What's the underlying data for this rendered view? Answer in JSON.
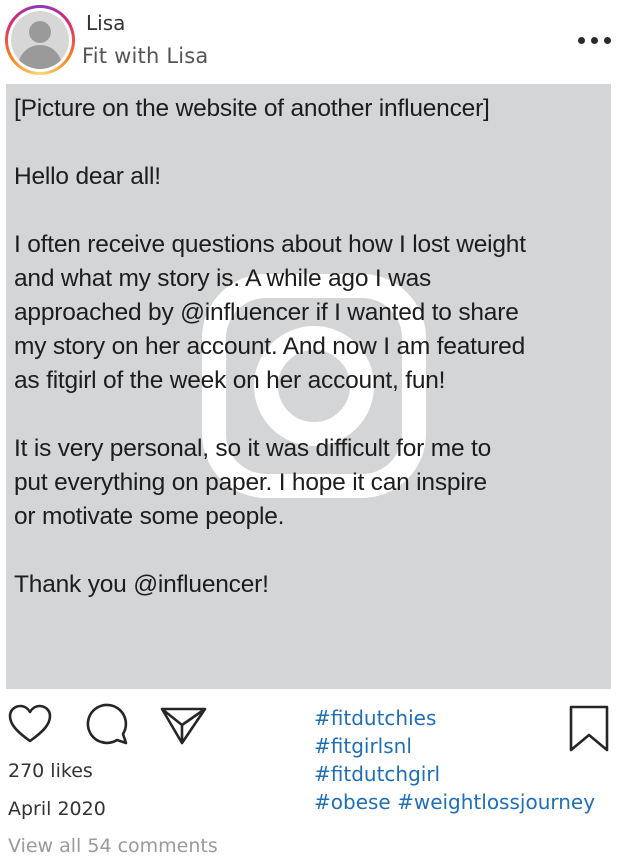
{
  "header": {
    "username": "Lisa",
    "subtitle": "Fit with Lisa"
  },
  "post": {
    "lines": [
      "[Picture on the website of another influencer]",
      "",
      "Hello dear all!",
      "",
      "I often receive questions about how I lost weight",
      "and what my story is. A while ago I was",
      "approached by @influencer if I wanted to share",
      "my story on her account. And now I am featured",
      "as fitgirl of the week on her account, fun!",
      "",
      "It is very personal, so it was difficult for me to",
      "put everything on paper. I hope it can inspire",
      "or motivate some people.",
      "",
      "Thank you @influencer!"
    ]
  },
  "footer": {
    "likes": "270 likes",
    "date": "April 2020",
    "view_comments": "View all 54 comments"
  },
  "hashtags": {
    "line1": "#fitdutchies",
    "line2": "#fitgirlsnl",
    "line3": "#fitdutchgirl",
    "line4a": "#obese",
    "line4b": "#weightlossjourney"
  },
  "icons": {
    "like": "heart-icon",
    "comment": "comment-bubble-icon",
    "share": "send-icon",
    "save": "bookmark-icon",
    "more": "more-options-icon",
    "watermark": "instagram-logo"
  },
  "colors": {
    "hashtag": "#1f6fb8",
    "post_background": "#d4d5d7",
    "muted": "#9a9a9a"
  }
}
